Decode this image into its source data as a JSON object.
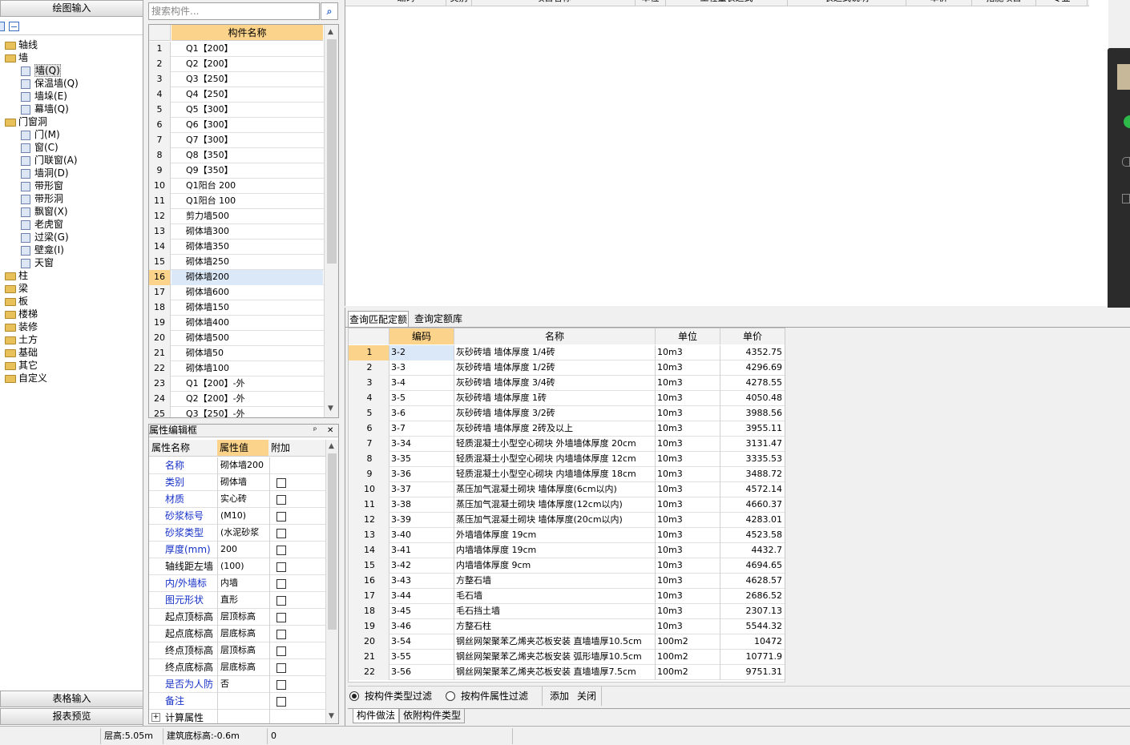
{
  "left_nav": {
    "top_tab": "绘图输入",
    "bottom_tabs": [
      "表格输入",
      "报表预览"
    ],
    "tree": [
      {
        "label": "轴线",
        "level": 0,
        "folder": true
      },
      {
        "label": "墙",
        "level": 0,
        "folder": true
      },
      {
        "label": "墙(Q)",
        "level": 1,
        "selected": true
      },
      {
        "label": "保温墙(Q)",
        "level": 1
      },
      {
        "label": "墙垛(E)",
        "level": 1
      },
      {
        "label": "幕墙(Q)",
        "level": 1
      },
      {
        "label": "门窗洞",
        "level": 0,
        "folder": true
      },
      {
        "label": "门(M)",
        "level": 1
      },
      {
        "label": "窗(C)",
        "level": 1
      },
      {
        "label": "门联窗(A)",
        "level": 1
      },
      {
        "label": "墙洞(D)",
        "level": 1
      },
      {
        "label": "带形窗",
        "level": 1
      },
      {
        "label": "带形洞",
        "level": 1
      },
      {
        "label": "飘窗(X)",
        "level": 1
      },
      {
        "label": "老虎窗",
        "level": 1
      },
      {
        "label": "过梁(G)",
        "level": 1
      },
      {
        "label": "壁龛(I)",
        "level": 1
      },
      {
        "label": "天窗",
        "level": 1
      },
      {
        "label": "柱",
        "level": 0,
        "folder": true
      },
      {
        "label": "梁",
        "level": 0,
        "folder": true
      },
      {
        "label": "板",
        "level": 0,
        "folder": true
      },
      {
        "label": "楼梯",
        "level": 0,
        "folder": true
      },
      {
        "label": "装修",
        "level": 0,
        "folder": true
      },
      {
        "label": "土方",
        "level": 0,
        "folder": true
      },
      {
        "label": "基础",
        "level": 0,
        "folder": true
      },
      {
        "label": "其它",
        "level": 0,
        "folder": true
      },
      {
        "label": "自定义",
        "level": 0,
        "folder": true
      }
    ]
  },
  "component_list": {
    "search_placeholder": "搜索构件...",
    "header": "构件名称",
    "selected_index": 16,
    "rows": [
      "Q1【200】",
      "Q2【200】",
      "Q3【250】",
      "Q4【250】",
      "Q5【300】",
      "Q6【300】",
      "Q7【300】",
      "Q8【350】",
      "Q9【350】",
      "Q1阳台 200",
      "Q1阳台 100",
      "剪力墙500",
      "砌体墙300",
      "砌体墙350",
      "砌体墙250",
      "砌体墙200",
      "砌体墙600",
      "砌体墙150",
      "砌体墙400",
      "砌体墙500",
      "砌体墙50",
      "砌体墙100",
      "Q1【200】-外",
      "Q2【200】-外",
      "Q3【250】-外"
    ]
  },
  "property_editor": {
    "title": "属性编辑框",
    "pin": "ᵖ",
    "close": "✕",
    "headers": [
      "属性名称",
      "属性值",
      "附加"
    ],
    "rows": [
      {
        "name": "名称",
        "value": "砌体墙200",
        "blue": true,
        "check": false
      },
      {
        "name": "类别",
        "value": "砌体墙",
        "blue": true,
        "check": true
      },
      {
        "name": "材质",
        "value": "实心砖",
        "blue": true,
        "check": true
      },
      {
        "name": "砂浆标号",
        "value": "(M10)",
        "blue": true,
        "check": true
      },
      {
        "name": "砂浆类型",
        "value": "(水泥砂浆",
        "blue": true,
        "check": true
      },
      {
        "name": "厚度(mm)",
        "value": "200",
        "blue": true,
        "check": true
      },
      {
        "name": "轴线距左墙",
        "value": "(100)",
        "blue": false,
        "check": true
      },
      {
        "name": "内/外墙标",
        "value": "内墙",
        "blue": true,
        "check": true
      },
      {
        "name": "图元形状",
        "value": "直形",
        "blue": true,
        "check": true
      },
      {
        "name": "起点顶标高",
        "value": "层顶标高",
        "blue": false,
        "check": true
      },
      {
        "name": "起点底标高",
        "value": "层底标高",
        "blue": false,
        "check": true
      },
      {
        "name": "终点顶标高",
        "value": "层顶标高",
        "blue": false,
        "check": true
      },
      {
        "name": "终点底标高",
        "value": "层底标高",
        "blue": false,
        "check": true
      },
      {
        "name": "是否为人防",
        "value": "否",
        "blue": true,
        "check": true
      },
      {
        "name": "备注",
        "value": "",
        "blue": true,
        "check": true
      },
      {
        "name": "计算属性",
        "value": "",
        "blue": false,
        "check": false,
        "expand": "+"
      }
    ]
  },
  "top_grid": {
    "headers": [
      "编码",
      "类别",
      "项目名称",
      "单位",
      "工程量表达式",
      "表达式说明",
      "单价",
      "措施项目",
      "专业"
    ]
  },
  "quota_panel": {
    "tabs": [
      "查询匹配定额",
      "查询定额库"
    ],
    "headers": [
      "编码",
      "名称",
      "单位",
      "单价"
    ],
    "rows": [
      {
        "code": "3-2",
        "name": "灰砂砖墙 墙体厚度 1/4砖",
        "unit": "10m3",
        "price": "4352.75"
      },
      {
        "code": "3-3",
        "name": "灰砂砖墙 墙体厚度 1/2砖",
        "unit": "10m3",
        "price": "4296.69"
      },
      {
        "code": "3-4",
        "name": "灰砂砖墙 墙体厚度 3/4砖",
        "unit": "10m3",
        "price": "4278.55"
      },
      {
        "code": "3-5",
        "name": "灰砂砖墙 墙体厚度 1砖",
        "unit": "10m3",
        "price": "4050.48"
      },
      {
        "code": "3-6",
        "name": "灰砂砖墙 墙体厚度 3/2砖",
        "unit": "10m3",
        "price": "3988.56"
      },
      {
        "code": "3-7",
        "name": "灰砂砖墙 墙体厚度 2砖及以上",
        "unit": "10m3",
        "price": "3955.11"
      },
      {
        "code": "3-34",
        "name": "轻质混凝土小型空心砌块 外墙墙体厚度 20cm",
        "unit": "10m3",
        "price": "3131.47"
      },
      {
        "code": "3-35",
        "name": "轻质混凝土小型空心砌块 内墙墙体厚度 12cm",
        "unit": "10m3",
        "price": "3335.53"
      },
      {
        "code": "3-36",
        "name": "轻质混凝土小型空心砌块 内墙墙体厚度 18cm",
        "unit": "10m3",
        "price": "3488.72"
      },
      {
        "code": "3-37",
        "name": "蒸压加气混凝土砌块 墙体厚度(6cm以内)",
        "unit": "10m3",
        "price": "4572.14"
      },
      {
        "code": "3-38",
        "name": "蒸压加气混凝土砌块 墙体厚度(12cm以内)",
        "unit": "10m3",
        "price": "4660.37"
      },
      {
        "code": "3-39",
        "name": "蒸压加气混凝土砌块 墙体厚度(20cm以内)",
        "unit": "10m3",
        "price": "4283.01"
      },
      {
        "code": "3-40",
        "name": "外墙墙体厚度 19cm",
        "unit": "10m3",
        "price": "4523.58"
      },
      {
        "code": "3-41",
        "name": "内墙墙体厚度 19cm",
        "unit": "10m3",
        "price": "4432.7"
      },
      {
        "code": "3-42",
        "name": "内墙墙体厚度 9cm",
        "unit": "10m3",
        "price": "4694.65"
      },
      {
        "code": "3-43",
        "name": "方整石墙",
        "unit": "10m3",
        "price": "4628.57"
      },
      {
        "code": "3-44",
        "name": "毛石墙",
        "unit": "10m3",
        "price": "2686.52"
      },
      {
        "code": "3-45",
        "name": "毛石挡土墙",
        "unit": "10m3",
        "price": "2307.13"
      },
      {
        "code": "3-46",
        "name": "方整石柱",
        "unit": "10m3",
        "price": "5544.32"
      },
      {
        "code": "3-54",
        "name": "钢丝网架聚苯乙烯夹芯板安装 直墙墙厚10.5cm",
        "unit": "100m2",
        "price": "10472"
      },
      {
        "code": "3-55",
        "name": "钢丝网架聚苯乙烯夹芯板安装 弧形墙厚10.5cm",
        "unit": "100m2",
        "price": "10771.9"
      },
      {
        "code": "3-56",
        "name": "钢丝网架聚苯乙烯夹芯板安装 直墙墙厚7.5cm",
        "unit": "100m2",
        "price": "9751.31"
      }
    ],
    "filter_options": [
      "按构件类型过滤",
      "按构件属性过滤"
    ],
    "filter_selected": 0,
    "actions": [
      "添加",
      "关闭"
    ],
    "bottom_tabs": [
      "构件做法",
      "依附构件类型"
    ]
  },
  "status_bar": {
    "floor_height": "层高:5.05m",
    "base_elevation": "建筑底标高:-0.6m",
    "value": "0"
  }
}
